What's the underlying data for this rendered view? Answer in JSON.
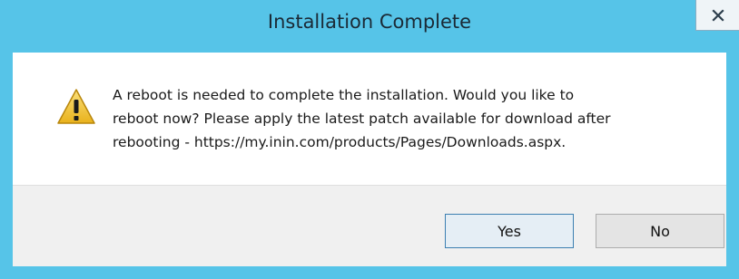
{
  "dialog": {
    "title": "Installation Complete",
    "close_icon": "close-icon",
    "warning_icon": "warning-icon",
    "message": "A reboot is needed to complete the installation.  Would you like to\nreboot now?  Please apply the latest patch available for download after\nrebooting - https://my.inin.com/products/Pages/Downloads.aspx.",
    "buttons": {
      "yes_label": "Yes",
      "no_label": "No"
    }
  },
  "colors": {
    "titlebar": "#56c4e8",
    "footer": "#f0f0f0",
    "warning": "#f2c232"
  }
}
